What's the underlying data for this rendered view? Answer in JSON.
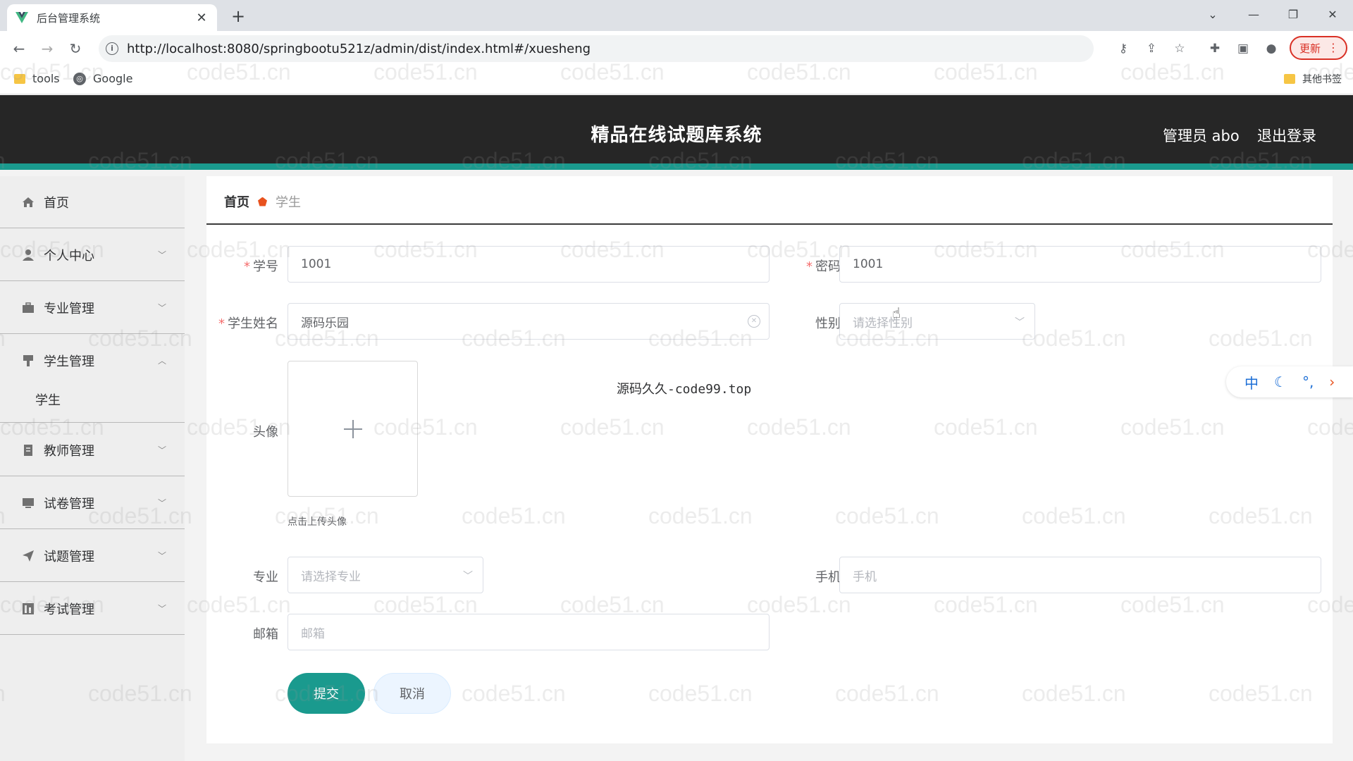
{
  "browser": {
    "tab_title": "后台管理系统",
    "url": "http://localhost:8080/springbootu521z/admin/dist/index.html#/xuesheng",
    "update_label": "更新",
    "bookmarks": [
      {
        "label": "tools"
      },
      {
        "label": "Google"
      }
    ],
    "other_bookmarks": "其他书签"
  },
  "header": {
    "title": "精品在线试题库系统",
    "admin_label": "管理员 abo",
    "logout_label": "退出登录",
    "accent_color": "#1a9a8e"
  },
  "sidebar": {
    "items": [
      {
        "label": "首页",
        "icon": "home-icon"
      },
      {
        "label": "个人中心",
        "icon": "user-icon",
        "expanded": false
      },
      {
        "label": "专业管理",
        "icon": "briefcase-icon",
        "expanded": false
      },
      {
        "label": "学生管理",
        "icon": "flag-icon",
        "expanded": true,
        "children": [
          {
            "label": "学生"
          }
        ]
      },
      {
        "label": "教师管理",
        "icon": "document-icon",
        "expanded": false
      },
      {
        "label": "试卷管理",
        "icon": "monitor-icon",
        "expanded": false
      },
      {
        "label": "试题管理",
        "icon": "send-icon",
        "expanded": false
      },
      {
        "label": "考试管理",
        "icon": "chart-icon",
        "expanded": false
      }
    ]
  },
  "breadcrumb": {
    "home": "首页",
    "current": "学生"
  },
  "form": {
    "student_id": {
      "label": "学号",
      "value": "1001",
      "required": true
    },
    "password": {
      "label": "密码",
      "value": "1001",
      "required": true
    },
    "student_name": {
      "label": "学生姓名",
      "value": "源码乐园",
      "required": true
    },
    "gender": {
      "label": "性别",
      "placeholder": "请选择性别"
    },
    "avatar": {
      "label": "头像",
      "tip": "点击上传头像"
    },
    "major": {
      "label": "专业",
      "placeholder": "请选择专业"
    },
    "phone": {
      "label": "手机",
      "placeholder": "手机"
    },
    "email": {
      "label": "邮箱",
      "placeholder": "邮箱"
    },
    "submit_label": "提交",
    "cancel_label": "取消"
  },
  "overlay_text": "源码久久-code99.top",
  "watermark": "code51.cn",
  "ime": {
    "mode": "中"
  }
}
